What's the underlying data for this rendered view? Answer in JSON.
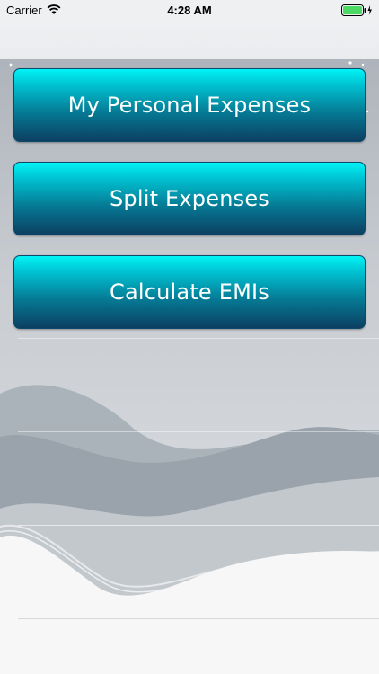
{
  "status_bar": {
    "carrier": "Carrier",
    "time": "4:28 AM",
    "wifi_icon": "wifi-icon",
    "battery_icon": "battery-charging-icon"
  },
  "menu": {
    "items": [
      {
        "label": "My Personal Expenses"
      },
      {
        "label": "Split Expenses"
      },
      {
        "label": "Calculate EMIs"
      }
    ]
  },
  "colors": {
    "button_top": "#00f3f5",
    "button_bottom": "#0c3f62",
    "background_wave": "#9ea6ae"
  }
}
